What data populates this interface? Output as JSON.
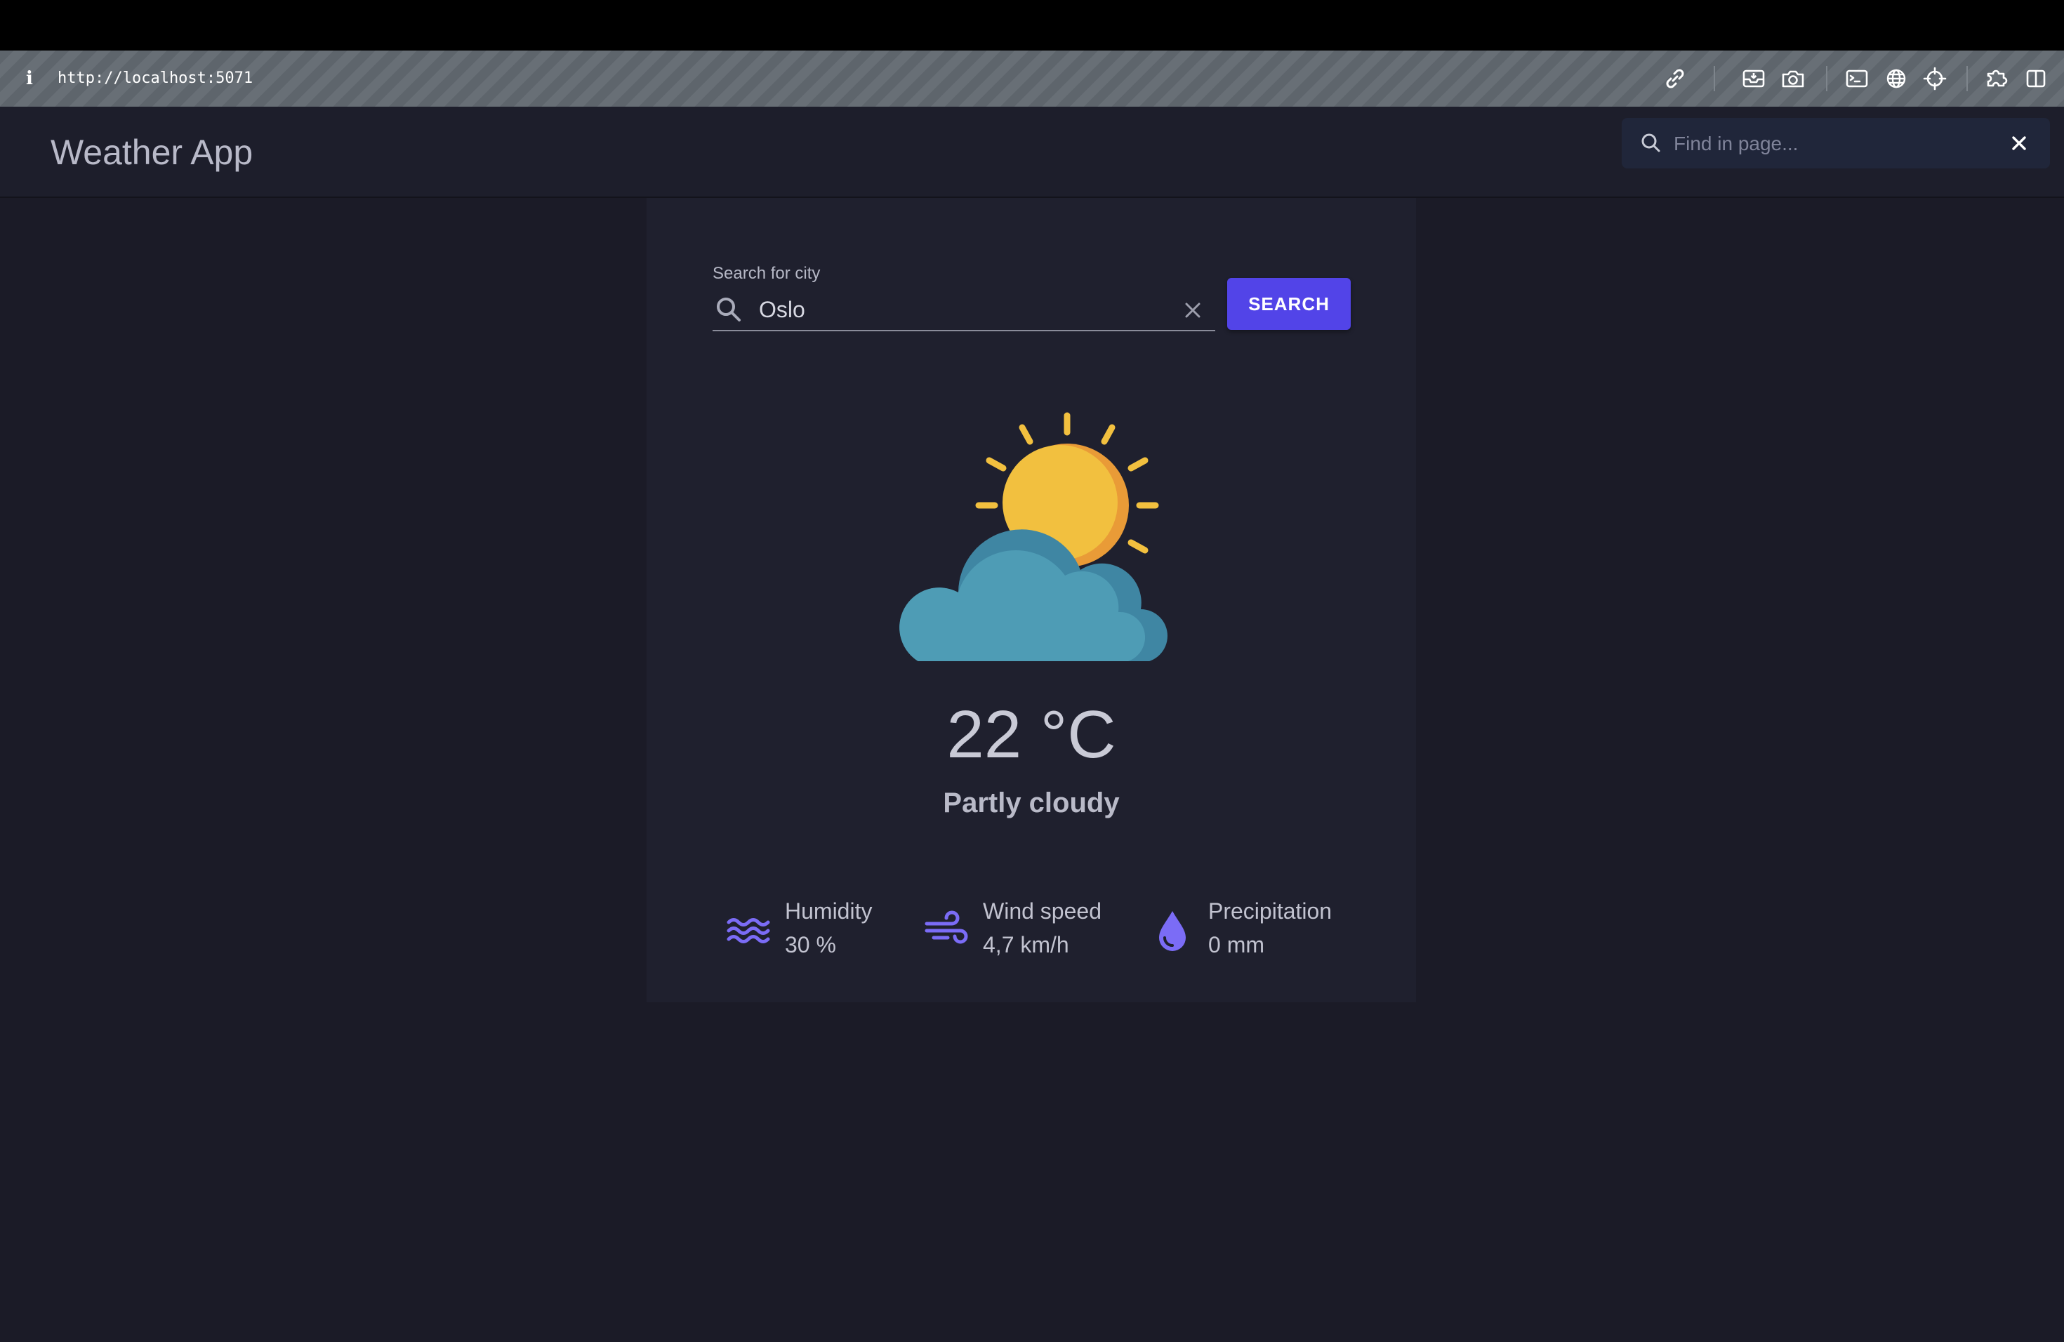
{
  "browser": {
    "info_icon_glyph": "i",
    "url": "http://localhost:5071",
    "toolbar_icons": [
      "link-icon",
      "inbox-icon",
      "camera-icon",
      "terminal-icon",
      "globe-icon",
      "crosshair-icon",
      "extension-icon",
      "split-view-icon"
    ]
  },
  "app": {
    "title": "Weather App"
  },
  "find_bar": {
    "placeholder": "Find in page..."
  },
  "search": {
    "label": "Search for city",
    "value": "Oslo",
    "button_label": "SEARCH"
  },
  "weather": {
    "icon": "partly-cloudy-icon",
    "temperature": "22 °C",
    "condition": "Partly cloudy",
    "stats": [
      {
        "icon": "waves-icon",
        "label": "Humidity",
        "value": "30 %"
      },
      {
        "icon": "wind-icon",
        "label": "Wind speed",
        "value": "4,7 km/h"
      },
      {
        "icon": "drop-icon",
        "label": "Precipitation",
        "value": "0 mm"
      }
    ]
  },
  "colors": {
    "accent": "#5244e8",
    "icon_accent": "#7b6cf6",
    "background": "#1b1b27",
    "card": "#1f202e",
    "sun": "#f2c03f",
    "sun_shadow": "#e99b37",
    "cloud": "#4e9cb5",
    "cloud_shadow": "#3f86a3"
  }
}
